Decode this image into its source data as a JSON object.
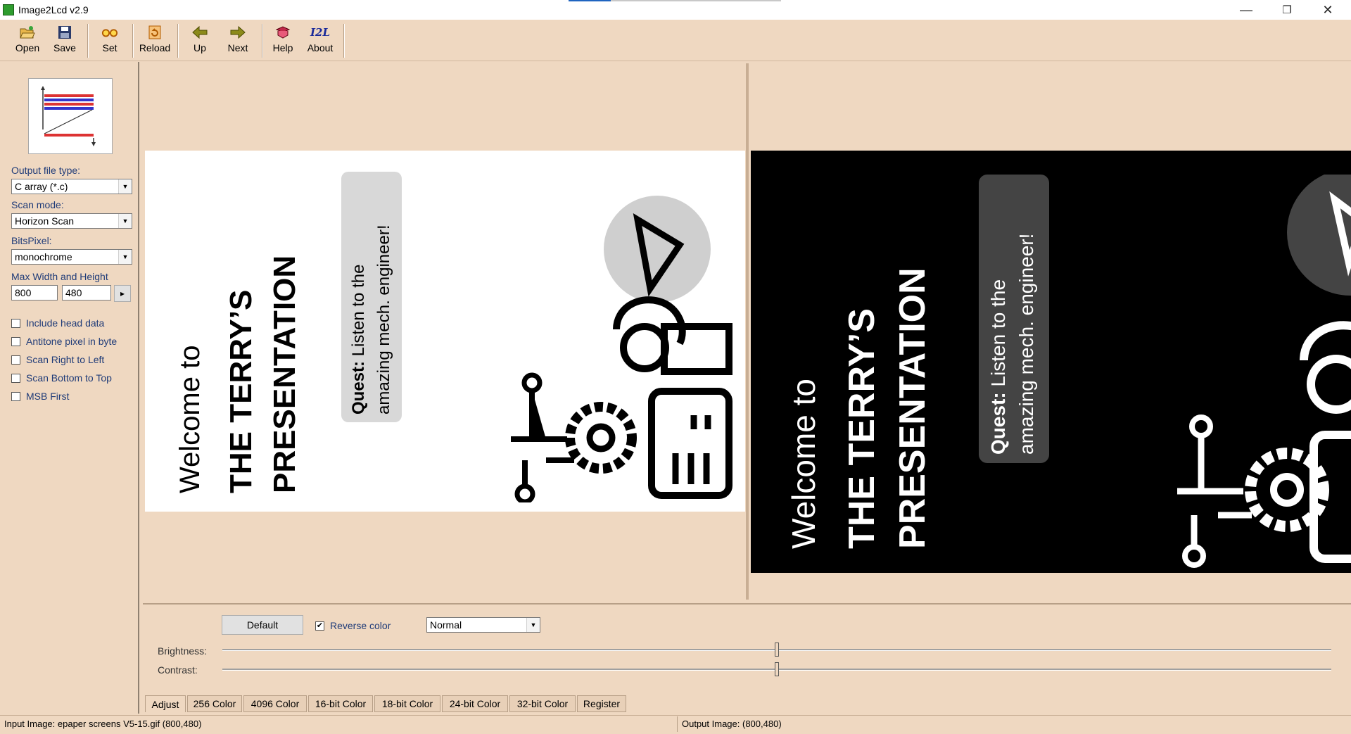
{
  "window": {
    "title": "Image2Lcd v2.9",
    "minimize_symbol": "—",
    "restore_symbol": "❐",
    "close_symbol": "✕"
  },
  "toolbar": {
    "buttons": [
      {
        "label": "Open",
        "icon": "folder-open-icon"
      },
      {
        "label": "Save",
        "icon": "floppy-disk-icon"
      },
      {
        "label": "Set",
        "icon": "glasses-icon"
      },
      {
        "label": "Reload",
        "icon": "reload-icon"
      },
      {
        "label": "Up",
        "icon": "arrow-left-icon"
      },
      {
        "label": "Next",
        "icon": "arrow-right-icon"
      },
      {
        "label": "Help",
        "icon": "help-icon"
      },
      {
        "label": "About",
        "icon": "i2l-logo-icon"
      }
    ]
  },
  "settings": {
    "output_file_type_label": "Output file type:",
    "output_file_type_value": "C array (*.c)",
    "scan_mode_label": "Scan mode:",
    "scan_mode_value": "Horizon Scan",
    "bits_pixel_label": "BitsPixel:",
    "bits_pixel_value": "monochrome",
    "max_size_label": "Max Width and Height",
    "max_width": "800",
    "max_height": "480",
    "apply_arrow": "▸",
    "options": [
      {
        "label": "Include head data",
        "checked": false
      },
      {
        "label": "Antitone pixel in byte",
        "checked": false
      },
      {
        "label": "Scan Right to Left",
        "checked": false
      },
      {
        "label": "Scan Bottom to Top",
        "checked": false
      },
      {
        "label": "MSB First",
        "checked": false
      }
    ]
  },
  "image_content": {
    "welcome": "Welcome to",
    "title_line1": "THE TERRY’S",
    "title_line2": "PRESENTATION",
    "quest_bold": "Quest:",
    "quest_rest": " Listen to the",
    "quest_line2": "amazing mech. engineer!"
  },
  "adjust": {
    "default_button": "Default",
    "reverse_color_label": "Reverse color",
    "reverse_color_checked": true,
    "mode_value": "Normal",
    "brightness_label": "Brightness:",
    "contrast_label": "Contrast:",
    "brightness_fraction": 0.5,
    "contrast_fraction": 0.5
  },
  "tabs": [
    "Adjust",
    "256 Color",
    "4096 Color",
    "16-bit Color",
    "18-bit Color",
    "24-bit Color",
    "32-bit Color",
    "Register"
  ],
  "status": {
    "input": "Input Image: epaper screens V5-15.gif (800,480)",
    "output": "Output Image: (800,480)"
  }
}
